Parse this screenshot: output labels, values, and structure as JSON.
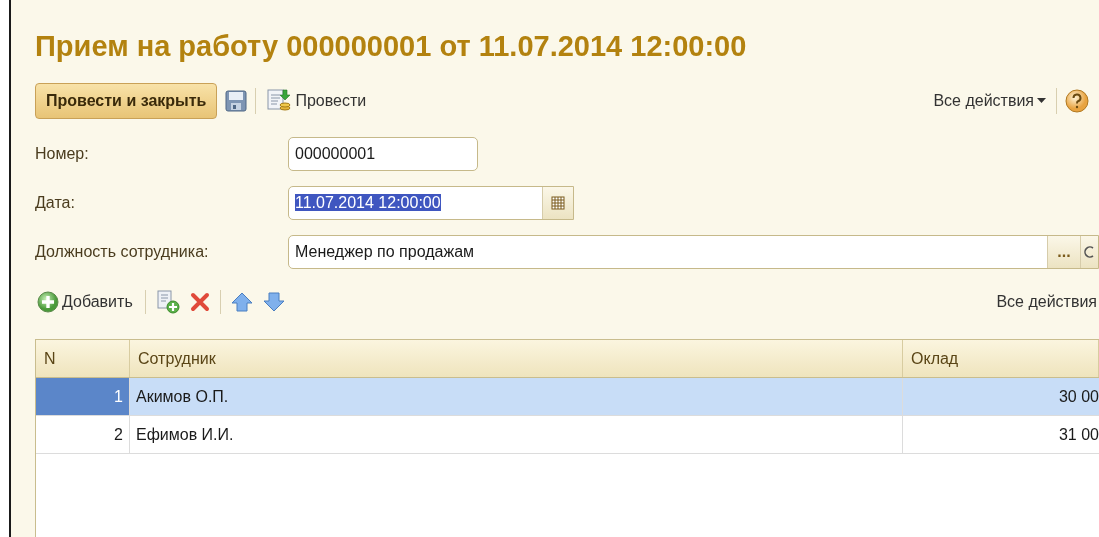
{
  "window": {
    "title": "Прием на работу 000000001 от 11.07.2014 12:00:00"
  },
  "toolbar": {
    "primary_button": "Провести и закрыть",
    "post_button": "Провести",
    "all_actions": "Все действия"
  },
  "fields": [
    {
      "label": "Номер:",
      "value": "000000001",
      "kind": "text",
      "text_selected": false
    },
    {
      "label": "Дата:",
      "value": "11.07.2014 12:00:00",
      "kind": "date",
      "text_selected": true
    },
    {
      "label": "Должность сотрудника:",
      "value": "Менеджер по продажам",
      "kind": "choice",
      "text_selected": false,
      "select_button": "..."
    }
  ],
  "table_toolbar": {
    "add_button": "Добавить",
    "all_actions": "Все действия"
  },
  "table": {
    "columns": [
      "N",
      "Сотрудник",
      "Оклад"
    ],
    "rows": [
      {
        "cells": [
          "1",
          "Акимов О.П.",
          "30 00"
        ],
        "selected": true
      },
      {
        "cells": [
          "2",
          "Ефимов И.И.",
          "31 00"
        ],
        "selected": false
      }
    ]
  }
}
